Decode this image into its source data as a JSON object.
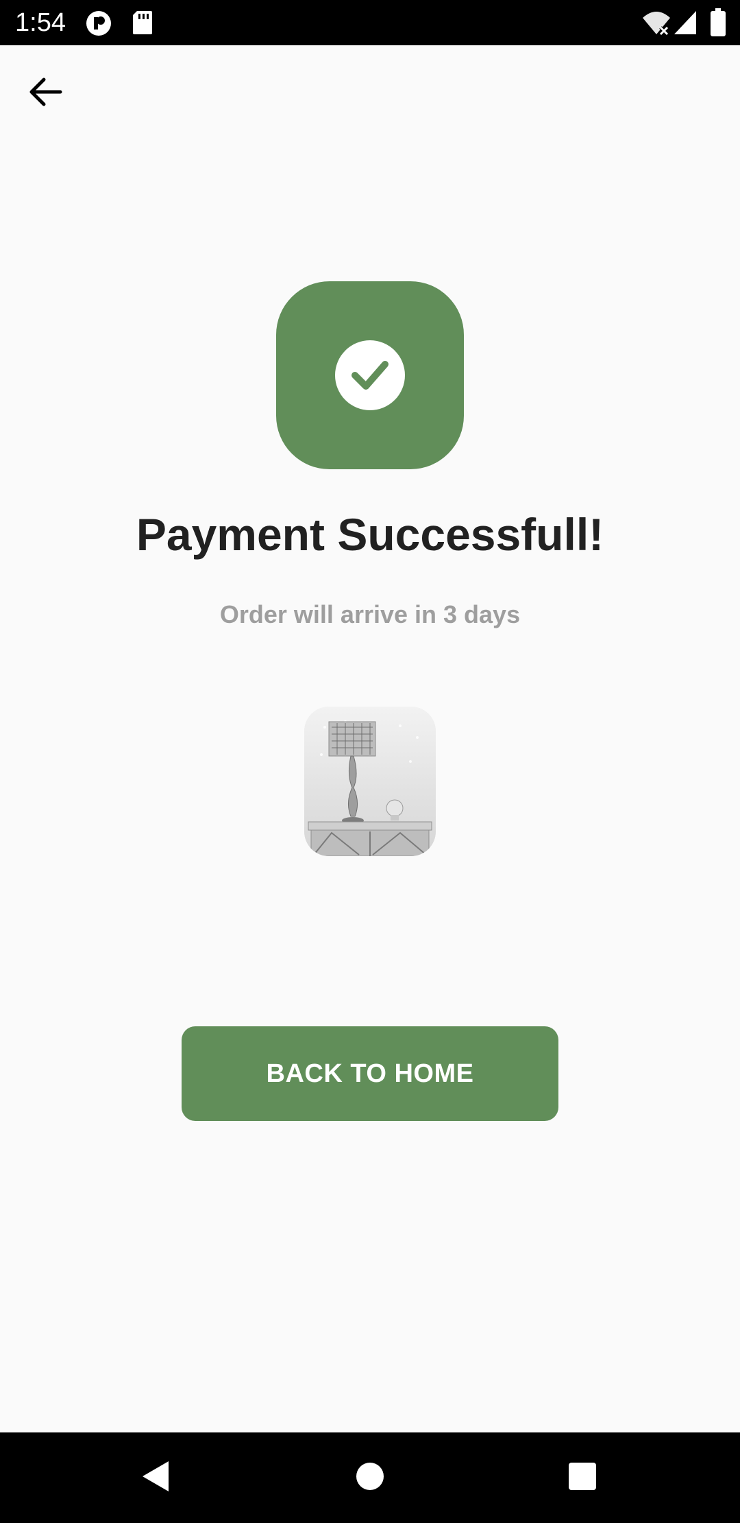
{
  "status_bar": {
    "time": "1:54",
    "icons": [
      "notification-app-icon",
      "sd-card-icon",
      "wifi-off-icon",
      "signal-icon",
      "battery-icon"
    ]
  },
  "app_bar": {
    "back_icon": "arrow-back-icon"
  },
  "main": {
    "badge_icon": "check-circle-icon",
    "title": "Payment Successfull!",
    "subtitle": "Order will arrive in 3 days",
    "product_image": "table-lamp-product-image",
    "button_label": "BACK TO HOME"
  },
  "nav_bar": {
    "icons": [
      "nav-back-icon",
      "nav-home-icon",
      "nav-recents-icon"
    ]
  },
  "colors": {
    "accent": "#618e59",
    "background": "#fafafa",
    "title": "#212121",
    "subtitle": "#9e9e9e"
  }
}
